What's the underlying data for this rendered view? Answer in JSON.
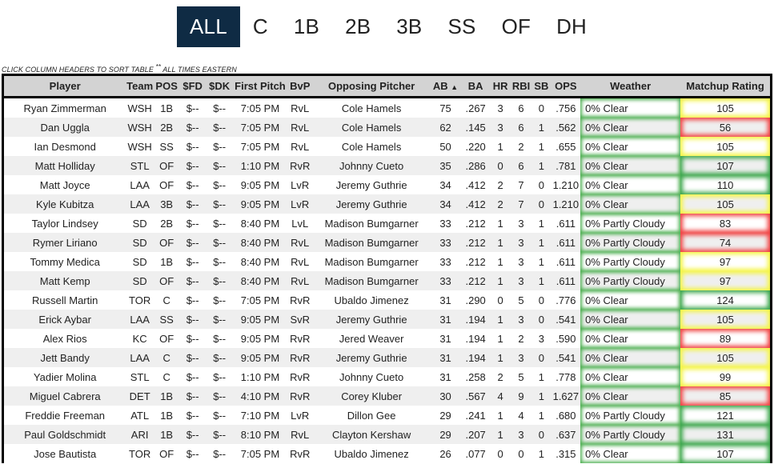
{
  "position_filter": {
    "active": "ALL",
    "tabs": [
      "ALL",
      "C",
      "1B",
      "2B",
      "3B",
      "SS",
      "OF",
      "DH"
    ]
  },
  "note": {
    "text": "CLICK COLUMN HEADERS TO SORT TABLE ",
    "stars": "**",
    "text2": " ALL TIMES EASTERN"
  },
  "colors": {
    "nav_active": "#0f2b44",
    "weather_glow": "#4caf50",
    "rating_green": "#3aa64a",
    "rating_yellow": "#f5f542",
    "rating_red": "#f04040"
  },
  "table": {
    "sort_column": "AB",
    "sort_indicator": "▲",
    "headers": [
      "Player",
      "Team",
      "POS",
      "$FD",
      "$DK",
      "First Pitch",
      "BvP",
      "Opposing Pitcher",
      "AB",
      "BA",
      "HR",
      "RBI",
      "SB",
      "OPS",
      "Weather",
      "Matchup Rating"
    ],
    "rows": [
      {
        "player": "Ryan Zimmerman",
        "team": "WSH",
        "pos": "1B",
        "fd": "$--",
        "dk": "$--",
        "pitch": "7:05 PM",
        "bvp": "RvL",
        "opp": "Cole Hamels",
        "ab": "75",
        "ba": ".267",
        "hr": "3",
        "rbi": "6",
        "sb": "0",
        "ops": ".756",
        "weather": "0% Clear",
        "rating": "105",
        "rating_level": "yellow"
      },
      {
        "player": "Dan Uggla",
        "team": "WSH",
        "pos": "2B",
        "fd": "$--",
        "dk": "$--",
        "pitch": "7:05 PM",
        "bvp": "RvL",
        "opp": "Cole Hamels",
        "ab": "62",
        "ba": ".145",
        "hr": "3",
        "rbi": "6",
        "sb": "1",
        "ops": ".562",
        "weather": "0% Clear",
        "rating": "56",
        "rating_level": "red"
      },
      {
        "player": "Ian Desmond",
        "team": "WSH",
        "pos": "SS",
        "fd": "$--",
        "dk": "$--",
        "pitch": "7:05 PM",
        "bvp": "RvL",
        "opp": "Cole Hamels",
        "ab": "50",
        "ba": ".220",
        "hr": "1",
        "rbi": "2",
        "sb": "1",
        "ops": ".655",
        "weather": "0% Clear",
        "rating": "105",
        "rating_level": "yellow"
      },
      {
        "player": "Matt Holliday",
        "team": "STL",
        "pos": "OF",
        "fd": "$--",
        "dk": "$--",
        "pitch": "1:10 PM",
        "bvp": "RvR",
        "opp": "Johnny Cueto",
        "ab": "35",
        "ba": ".286",
        "hr": "0",
        "rbi": "6",
        "sb": "1",
        "ops": ".781",
        "weather": "0% Clear",
        "rating": "107",
        "rating_level": "green"
      },
      {
        "player": "Matt Joyce",
        "team": "LAA",
        "pos": "OF",
        "fd": "$--",
        "dk": "$--",
        "pitch": "9:05 PM",
        "bvp": "LvR",
        "opp": "Jeremy Guthrie",
        "ab": "34",
        "ba": ".412",
        "hr": "2",
        "rbi": "7",
        "sb": "0",
        "ops": "1.210",
        "weather": "0% Clear",
        "rating": "110",
        "rating_level": "green"
      },
      {
        "player": "Kyle Kubitza",
        "team": "LAA",
        "pos": "3B",
        "fd": "$--",
        "dk": "$--",
        "pitch": "9:05 PM",
        "bvp": "LvR",
        "opp": "Jeremy Guthrie",
        "ab": "34",
        "ba": ".412",
        "hr": "2",
        "rbi": "7",
        "sb": "0",
        "ops": "1.210",
        "weather": "0% Clear",
        "rating": "105",
        "rating_level": "yellow"
      },
      {
        "player": "Taylor Lindsey",
        "team": "SD",
        "pos": "2B",
        "fd": "$--",
        "dk": "$--",
        "pitch": "8:40 PM",
        "bvp": "LvL",
        "opp": "Madison Bumgarner",
        "ab": "33",
        "ba": ".212",
        "hr": "1",
        "rbi": "3",
        "sb": "1",
        "ops": ".611",
        "weather": "0% Partly Cloudy",
        "rating": "83",
        "rating_level": "red"
      },
      {
        "player": "Rymer Liriano",
        "team": "SD",
        "pos": "OF",
        "fd": "$--",
        "dk": "$--",
        "pitch": "8:40 PM",
        "bvp": "RvL",
        "opp": "Madison Bumgarner",
        "ab": "33",
        "ba": ".212",
        "hr": "1",
        "rbi": "3",
        "sb": "1",
        "ops": ".611",
        "weather": "0% Partly Cloudy",
        "rating": "74",
        "rating_level": "red"
      },
      {
        "player": "Tommy Medica",
        "team": "SD",
        "pos": "1B",
        "fd": "$--",
        "dk": "$--",
        "pitch": "8:40 PM",
        "bvp": "RvL",
        "opp": "Madison Bumgarner",
        "ab": "33",
        "ba": ".212",
        "hr": "1",
        "rbi": "3",
        "sb": "1",
        "ops": ".611",
        "weather": "0% Partly Cloudy",
        "rating": "97",
        "rating_level": "yellow"
      },
      {
        "player": "Matt Kemp",
        "team": "SD",
        "pos": "OF",
        "fd": "$--",
        "dk": "$--",
        "pitch": "8:40 PM",
        "bvp": "RvL",
        "opp": "Madison Bumgarner",
        "ab": "33",
        "ba": ".212",
        "hr": "1",
        "rbi": "3",
        "sb": "1",
        "ops": ".611",
        "weather": "0% Partly Cloudy",
        "rating": "97",
        "rating_level": "yellow"
      },
      {
        "player": "Russell Martin",
        "team": "TOR",
        "pos": "C",
        "fd": "$--",
        "dk": "$--",
        "pitch": "7:05 PM",
        "bvp": "RvR",
        "opp": "Ubaldo Jimenez",
        "ab": "31",
        "ba": ".290",
        "hr": "0",
        "rbi": "5",
        "sb": "0",
        "ops": ".776",
        "weather": "0% Clear",
        "rating": "124",
        "rating_level": "green"
      },
      {
        "player": "Erick Aybar",
        "team": "LAA",
        "pos": "SS",
        "fd": "$--",
        "dk": "$--",
        "pitch": "9:05 PM",
        "bvp": "SvR",
        "opp": "Jeremy Guthrie",
        "ab": "31",
        "ba": ".194",
        "hr": "1",
        "rbi": "3",
        "sb": "0",
        "ops": ".541",
        "weather": "0% Clear",
        "rating": "105",
        "rating_level": "yellow"
      },
      {
        "player": "Alex Rios",
        "team": "KC",
        "pos": "OF",
        "fd": "$--",
        "dk": "$--",
        "pitch": "9:05 PM",
        "bvp": "RvR",
        "opp": "Jered Weaver",
        "ab": "31",
        "ba": ".194",
        "hr": "1",
        "rbi": "2",
        "sb": "3",
        "ops": ".590",
        "weather": "0% Clear",
        "rating": "89",
        "rating_level": "red"
      },
      {
        "player": "Jett Bandy",
        "team": "LAA",
        "pos": "C",
        "fd": "$--",
        "dk": "$--",
        "pitch": "9:05 PM",
        "bvp": "RvR",
        "opp": "Jeremy Guthrie",
        "ab": "31",
        "ba": ".194",
        "hr": "1",
        "rbi": "3",
        "sb": "0",
        "ops": ".541",
        "weather": "0% Clear",
        "rating": "105",
        "rating_level": "yellow"
      },
      {
        "player": "Yadier Molina",
        "team": "STL",
        "pos": "C",
        "fd": "$--",
        "dk": "$--",
        "pitch": "1:10 PM",
        "bvp": "RvR",
        "opp": "Johnny Cueto",
        "ab": "31",
        "ba": ".258",
        "hr": "2",
        "rbi": "5",
        "sb": "1",
        "ops": ".778",
        "weather": "0% Clear",
        "rating": "99",
        "rating_level": "yellow"
      },
      {
        "player": "Miguel Cabrera",
        "team": "DET",
        "pos": "1B",
        "fd": "$--",
        "dk": "$--",
        "pitch": "4:10 PM",
        "bvp": "RvR",
        "opp": "Corey Kluber",
        "ab": "30",
        "ba": ".567",
        "hr": "4",
        "rbi": "9",
        "sb": "1",
        "ops": "1.627",
        "weather": "0% Clear",
        "rating": "85",
        "rating_level": "red"
      },
      {
        "player": "Freddie Freeman",
        "team": "ATL",
        "pos": "1B",
        "fd": "$--",
        "dk": "$--",
        "pitch": "7:10 PM",
        "bvp": "LvR",
        "opp": "Dillon Gee",
        "ab": "29",
        "ba": ".241",
        "hr": "1",
        "rbi": "4",
        "sb": "1",
        "ops": ".680",
        "weather": "0% Partly Cloudy",
        "rating": "121",
        "rating_level": "green"
      },
      {
        "player": "Paul Goldschmidt",
        "team": "ARI",
        "pos": "1B",
        "fd": "$--",
        "dk": "$--",
        "pitch": "8:10 PM",
        "bvp": "RvL",
        "opp": "Clayton Kershaw",
        "ab": "29",
        "ba": ".207",
        "hr": "1",
        "rbi": "3",
        "sb": "0",
        "ops": ".637",
        "weather": "0% Partly Cloudy",
        "rating": "131",
        "rating_level": "green"
      },
      {
        "player": "Jose Bautista",
        "team": "TOR",
        "pos": "OF",
        "fd": "$--",
        "dk": "$--",
        "pitch": "7:05 PM",
        "bvp": "RvR",
        "opp": "Ubaldo Jimenez",
        "ab": "26",
        "ba": ".077",
        "hr": "0",
        "rbi": "0",
        "sb": "1",
        "ops": ".315",
        "weather": "0% Clear",
        "rating": "107",
        "rating_level": "green"
      }
    ]
  }
}
